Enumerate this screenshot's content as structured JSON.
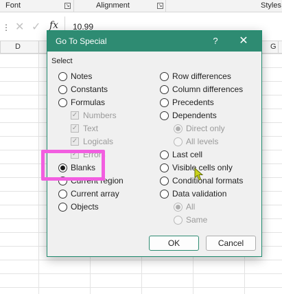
{
  "ribbon": {
    "font_group": "Font",
    "alignment_group": "Alignment",
    "styles_group": "Styles"
  },
  "formula_bar": {
    "cancel_glyph": "✕",
    "enter_glyph": "✓",
    "fx_label": "fx",
    "value": "10.99"
  },
  "columns": {
    "left": "D",
    "right": "G"
  },
  "dialog": {
    "title": "Go To Special",
    "help_label": "?",
    "close_label": "✕",
    "select_label": "Select",
    "left_options": [
      {
        "label": "Notes"
      },
      {
        "label": "Constants"
      },
      {
        "label": "Formulas"
      },
      {
        "label": "Numbers"
      },
      {
        "label": "Text"
      },
      {
        "label": "Logicals"
      },
      {
        "label": "Errors"
      },
      {
        "label": "Blanks"
      },
      {
        "label": "Current region"
      },
      {
        "label": "Current array"
      },
      {
        "label": "Objects"
      }
    ],
    "right_options": [
      {
        "label": "Row differences"
      },
      {
        "label": "Column differences"
      },
      {
        "label": "Precedents"
      },
      {
        "label": "Dependents"
      },
      {
        "label": "Direct only"
      },
      {
        "label": "All levels"
      },
      {
        "label": "Last cell"
      },
      {
        "label": "Visible cells only"
      },
      {
        "label": "Conditional formats"
      },
      {
        "label": "Data validation"
      },
      {
        "label": "All"
      },
      {
        "label": "Same"
      }
    ],
    "selected": "Blanks",
    "ok_label": "OK",
    "cancel_label": "Cancel"
  },
  "colors": {
    "dialog_accent": "#2e8b72",
    "highlight": "#f25ee0",
    "cursor": "#c9d11a"
  }
}
